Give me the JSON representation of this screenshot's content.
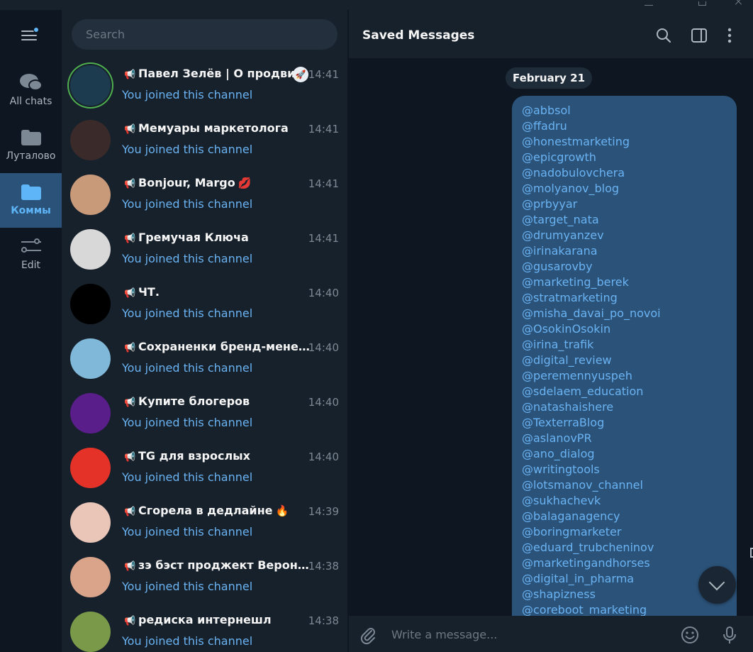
{
  "window": {
    "controls": [
      "minimize",
      "maximize",
      "close"
    ]
  },
  "rail": {
    "menu_icon": "hamburger-menu-icon",
    "folders": [
      {
        "label": "All chats",
        "icon": "chat-bubbles-icon"
      },
      {
        "label": "Луталово",
        "icon": "folder-icon"
      },
      {
        "label": "Коммы",
        "icon": "folder-icon",
        "active": true
      },
      {
        "label": "Edit",
        "icon": "sliders-edit-icon"
      }
    ],
    "accent": "#5eb5f7"
  },
  "search": {
    "placeholder": "Search"
  },
  "chats": [
    {
      "name": "Павел Зелёв | О продви...",
      "time": "14:41",
      "last": "You joined this channel",
      "avatar_color": "#1d3b4f",
      "pinned": true
    },
    {
      "name": "Мемуары маркетолога",
      "time": "14:41",
      "last": "You joined this channel",
      "avatar_color": "#3a2a2a"
    },
    {
      "name": "Bonjour, Margo",
      "emoji": "💋",
      "time": "14:41",
      "last": "You joined this channel",
      "avatar_color": "#c89a7a"
    },
    {
      "name": "Гремучая Ключа",
      "time": "14:41",
      "last": "You joined this channel",
      "avatar_color": "#d8d8d8"
    },
    {
      "name": "ЧТ.",
      "time": "14:40",
      "last": "You joined this channel",
      "avatar_color": "#000000"
    },
    {
      "name": "Сохраненки бренд-менедж...",
      "time": "14:40",
      "last": "You joined this channel",
      "avatar_color": "#7fb8d8"
    },
    {
      "name": "Купите блогеров",
      "time": "14:40",
      "last": "You joined this channel",
      "avatar_color": "#5a1e8a"
    },
    {
      "name": "TG для взрослых",
      "time": "14:40",
      "last": "You joined this channel",
      "avatar_color": "#e53228"
    },
    {
      "name": "Сгорела в дедлайне",
      "emoji": "🔥",
      "time": "14:39",
      "last": "You joined this channel",
      "avatar_color": "#e9c6b8"
    },
    {
      "name": "зэ бэст проджект Вероника",
      "time": "14:38",
      "last": "You joined this channel",
      "avatar_color": "#d9a48a"
    },
    {
      "name": "редиска интернешл",
      "time": "14:38",
      "last": "You joined this channel",
      "avatar_color": "#7a9a4a"
    }
  ],
  "chat_panel": {
    "title": "Saved Messages",
    "header_icons": [
      "search-icon",
      "sidebar-toggle-icon",
      "more-vertical-icon"
    ],
    "date_label": "February 21",
    "handles": [
      "@abbsol",
      "@ffadru",
      "@honestmarketing",
      "@epicgrowth",
      "@nadobulovchera",
      "@molyanov_blog",
      "@prbyyar",
      "@target_nata",
      "@drumyanzev",
      "@irinakarana",
      "@gusarovby",
      "@marketing_berek",
      "@stratmarketing",
      "@misha_davai_po_novoi",
      "@OsokinOsokin",
      "@irina_trafik",
      "@digital_review",
      "@peremennyuspeh",
      "@sdelaem_education",
      "@natashaishere",
      "@TexterraBlog",
      "@aslanovPR",
      "@ano_dialog",
      "@writingtools",
      "@lotsmanov_channel",
      "@sukhachevk",
      "@balaganagency",
      "@boringmarketer",
      "@eduard_trubcheninov",
      "@marketingandhorses",
      "@digital_in_pharma",
      "@shapizness",
      "@coreboot_marketing"
    ],
    "composer_placeholder": "Write a message...",
    "link_color": "#6ab3f3",
    "bubble_color": "#2b5278"
  }
}
